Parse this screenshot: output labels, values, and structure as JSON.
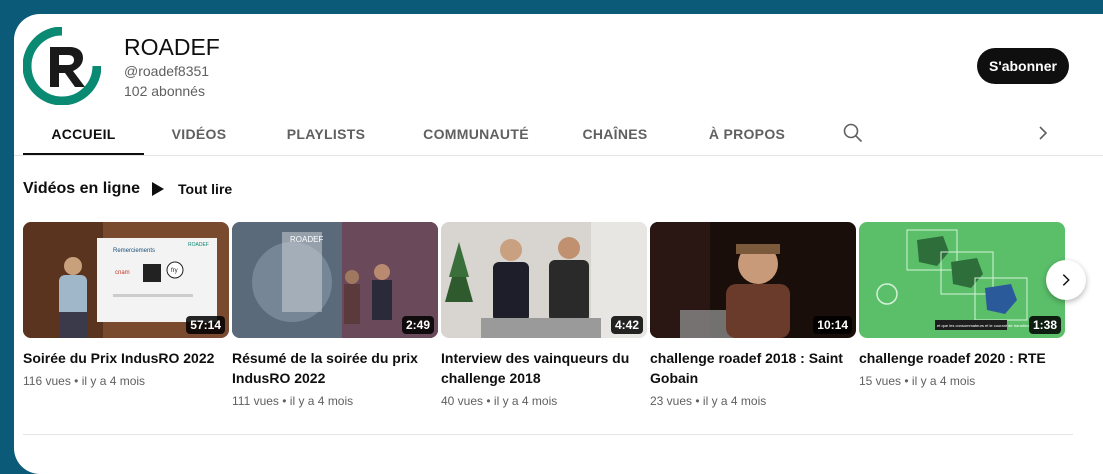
{
  "channel": {
    "name": "ROADEF",
    "handle": "@roadef8351",
    "subscribers": "102 abonnés",
    "subscribe_label": "S'abonner",
    "avatar_letter": "R",
    "brand_color": "#00897b"
  },
  "tabs": [
    {
      "label": "ACCUEIL",
      "active": true
    },
    {
      "label": "VIDÉOS",
      "active": false
    },
    {
      "label": "PLAYLISTS",
      "active": false
    },
    {
      "label": "COMMUNAUTÉ",
      "active": false
    },
    {
      "label": "CHAÎNES",
      "active": false
    },
    {
      "label": "À PROPOS",
      "active": false
    }
  ],
  "section": {
    "title": "Vidéos en ligne",
    "play_all_label": "Tout lire"
  },
  "thumb_text": {
    "slide_heading": "Remerciements",
    "slide_logo": "ROADEF",
    "cnam": "cnam",
    "fry": "fry",
    "sponsor": "ROADEF",
    "rte_caption": "et que les consommateurs et le courant de transition"
  },
  "videos": [
    {
      "title": "Soirée du Prix IndusRO 2022",
      "duration": "57:14",
      "views": "116 vues",
      "age": "il y a 4 mois"
    },
    {
      "title": "Résumé de la soirée du prix IndusRO 2022",
      "duration": "2:49",
      "views": "111 vues",
      "age": "il y a 4 mois"
    },
    {
      "title": "Interview des vainqueurs du challenge 2018",
      "duration": "4:42",
      "views": "40 vues",
      "age": "il y a 4 mois"
    },
    {
      "title": "challenge roadef 2018 : Saint Gobain",
      "duration": "10:14",
      "views": "23 vues",
      "age": "il y a 4 mois"
    },
    {
      "title": "challenge roadef 2020 : RTE",
      "duration": "1:38",
      "views": "15 vues",
      "age": "il y a 4 mois"
    }
  ],
  "icons": {
    "search": "search-icon",
    "tabs_next": "chevron-right-icon",
    "play_all": "play-icon",
    "carousel_next": "chevron-right-icon"
  }
}
